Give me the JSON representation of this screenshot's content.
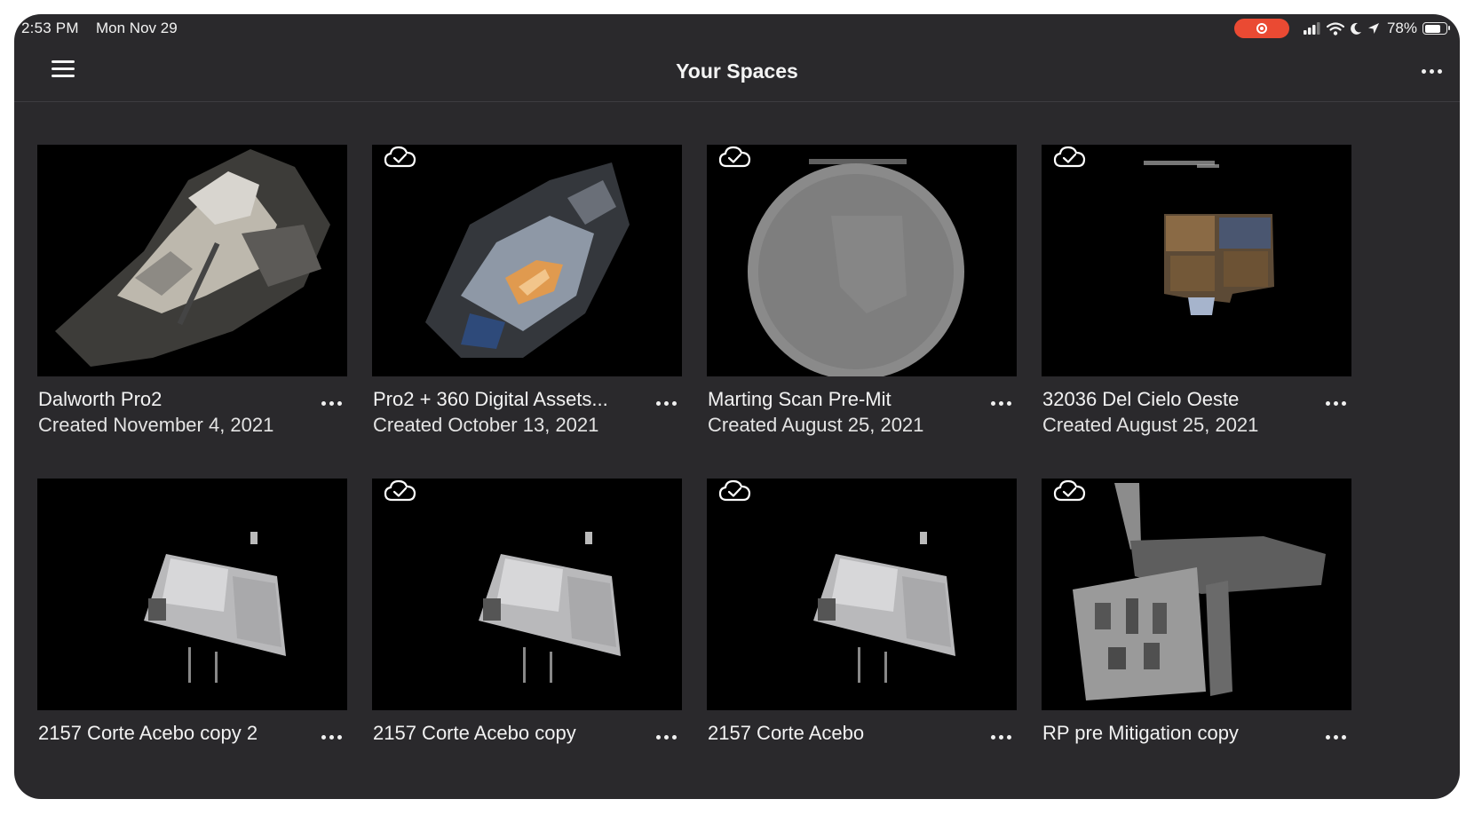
{
  "status_bar": {
    "time": "2:53 PM",
    "date": "Mon Nov 29",
    "battery_percent_label": "78%",
    "battery_level": 0.78,
    "recording": true
  },
  "nav": {
    "title": "Your Spaces",
    "menu_icon": "hamburger-menu-icon",
    "more_icon": "more-horizontal-icon"
  },
  "colors": {
    "background": "#2a292c",
    "thumbnail_bg": "#000000",
    "recording_pill": "#ea4a33",
    "text": "#f2f2f2"
  },
  "spaces": [
    {
      "title": "Dalworth Pro2",
      "created": "Created November 4, 2021",
      "synced": false
    },
    {
      "title": "Pro2 + 360 Digital Assets...",
      "created": "Created October 13, 2021",
      "synced": true
    },
    {
      "title": "Marting Scan Pre-Mit",
      "created": "Created August 25, 2021",
      "synced": true
    },
    {
      "title": "32036 Del Cielo Oeste",
      "created": "Created August 25, 2021",
      "synced": true
    },
    {
      "title": "2157 Corte Acebo copy 2",
      "created": "",
      "synced": false
    },
    {
      "title": "2157 Corte Acebo copy",
      "created": "",
      "synced": true
    },
    {
      "title": "2157 Corte Acebo",
      "created": "",
      "synced": true
    },
    {
      "title": "RP pre Mitigation copy",
      "created": "",
      "synced": true
    }
  ]
}
